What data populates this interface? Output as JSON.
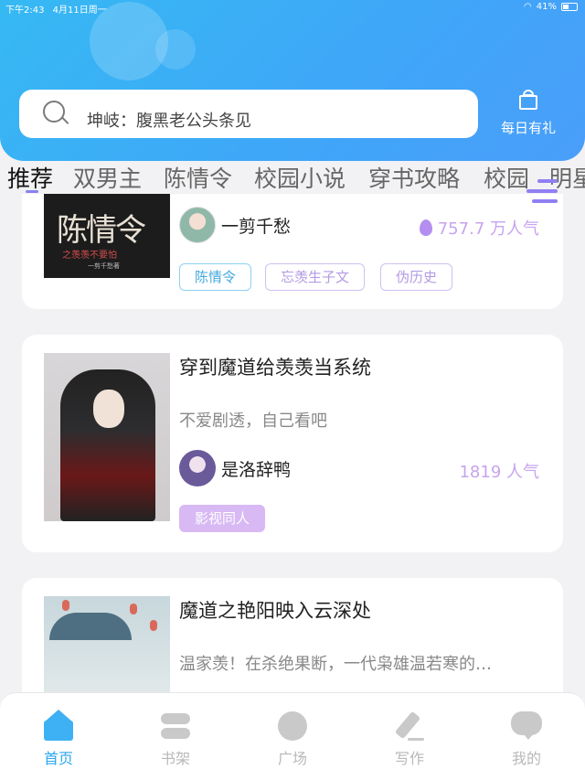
{
  "status_bar": {
    "time": "下午2:43",
    "date": "4月11日周一",
    "battery": "41%"
  },
  "search": {
    "placeholder": "坤岐：腹黑老公头条见"
  },
  "daily_gift": {
    "label": "每日有礼"
  },
  "tabs": [
    {
      "label": "推荐",
      "active": true
    },
    {
      "label": "双男主"
    },
    {
      "label": "陈情令"
    },
    {
      "label": "校园小说"
    },
    {
      "label": "穿书攻略"
    },
    {
      "label": "校园"
    },
    {
      "label": "明星"
    }
  ],
  "books": [
    {
      "cover_text": {
        "title": "陈情令",
        "subtitle": "之羡羡不要怕",
        "author": "一剪千愁著"
      },
      "author": "一剪千愁",
      "popularity": "757.7 万人气",
      "tags": [
        "陈情令",
        "忘羡生子文",
        "伪历史"
      ]
    },
    {
      "title": "穿到魔道给羡羡当系统",
      "description": "不爱剧透，自己看吧",
      "author": "是洛辞鸭",
      "popularity": "1819 人气",
      "tags": [
        "影视同人"
      ]
    },
    {
      "title": "魔道之艳阳映入云深处",
      "description": "温家羡！在杀绝果断，一代枭雄温若寒的…"
    }
  ],
  "bottom_nav": [
    {
      "label": "首页",
      "icon": "home-icon",
      "active": true
    },
    {
      "label": "书架",
      "icon": "bookshelf-icon"
    },
    {
      "label": "广场",
      "icon": "planet-icon"
    },
    {
      "label": "写作",
      "icon": "pen-icon"
    },
    {
      "label": "我的",
      "icon": "chat-icon"
    }
  ],
  "colors": {
    "accent_blue": "#36b9f3",
    "accent_purple": "#b48ef0",
    "nav_active": "#2aa7f1"
  }
}
